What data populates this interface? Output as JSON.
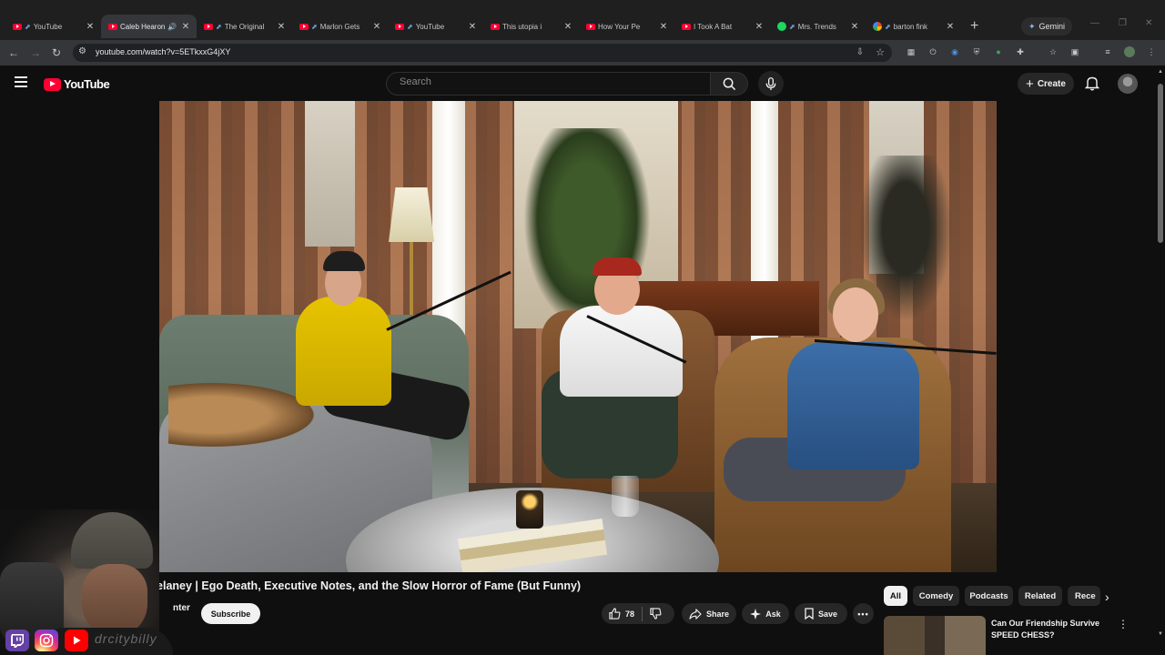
{
  "browser": {
    "tabs": [
      {
        "title": "YouTube",
        "favicon": "youtube-icon",
        "pinned": true
      },
      {
        "title": "Caleb Hearon",
        "favicon": "youtube-icon",
        "active": true,
        "audio": true
      },
      {
        "title": "The Original",
        "favicon": "youtube-icon",
        "pinned": true
      },
      {
        "title": "Marlon Gets",
        "favicon": "youtube-icon",
        "pinned": true
      },
      {
        "title": "YouTube",
        "favicon": "youtube-icon",
        "pinned": true
      },
      {
        "title": "This utopia i",
        "favicon": "youtube-icon"
      },
      {
        "title": "How Your Pe",
        "favicon": "youtube-icon"
      },
      {
        "title": "I Took A Bat",
        "favicon": "youtube-icon"
      },
      {
        "title": "Mrs. Trends",
        "favicon": "spotify-icon",
        "pinned": true
      },
      {
        "title": "barton fink",
        "favicon": "google-icon",
        "pinned": true
      }
    ],
    "gemini_label": "Gemini",
    "url": "youtube.com/watch?v=5ETkxxG4jXY"
  },
  "youtube": {
    "logo_text": "YouTube",
    "search_placeholder": "Search",
    "create_label": "Create"
  },
  "video": {
    "title_visible": "Delaney | Ego Death, Executive Notes, and the Slow Horror of Fame (But Funny)",
    "channel_fragment": "nter",
    "subscribe_label": "Subscribe",
    "likes": "78",
    "share_label": "Share",
    "ask_label": "Ask",
    "save_label": "Save"
  },
  "chips": [
    "All",
    "Comedy",
    "Podcasts",
    "Related",
    "Rece"
  ],
  "recommendation": {
    "title": "Can Our Friendship Survive SPEED CHESS?"
  },
  "overlay": {
    "handle": "drcitybilly"
  },
  "colors": {
    "youtube_red": "#ff0033",
    "background": "#0f0f0f",
    "chip_bg": "#272727"
  }
}
